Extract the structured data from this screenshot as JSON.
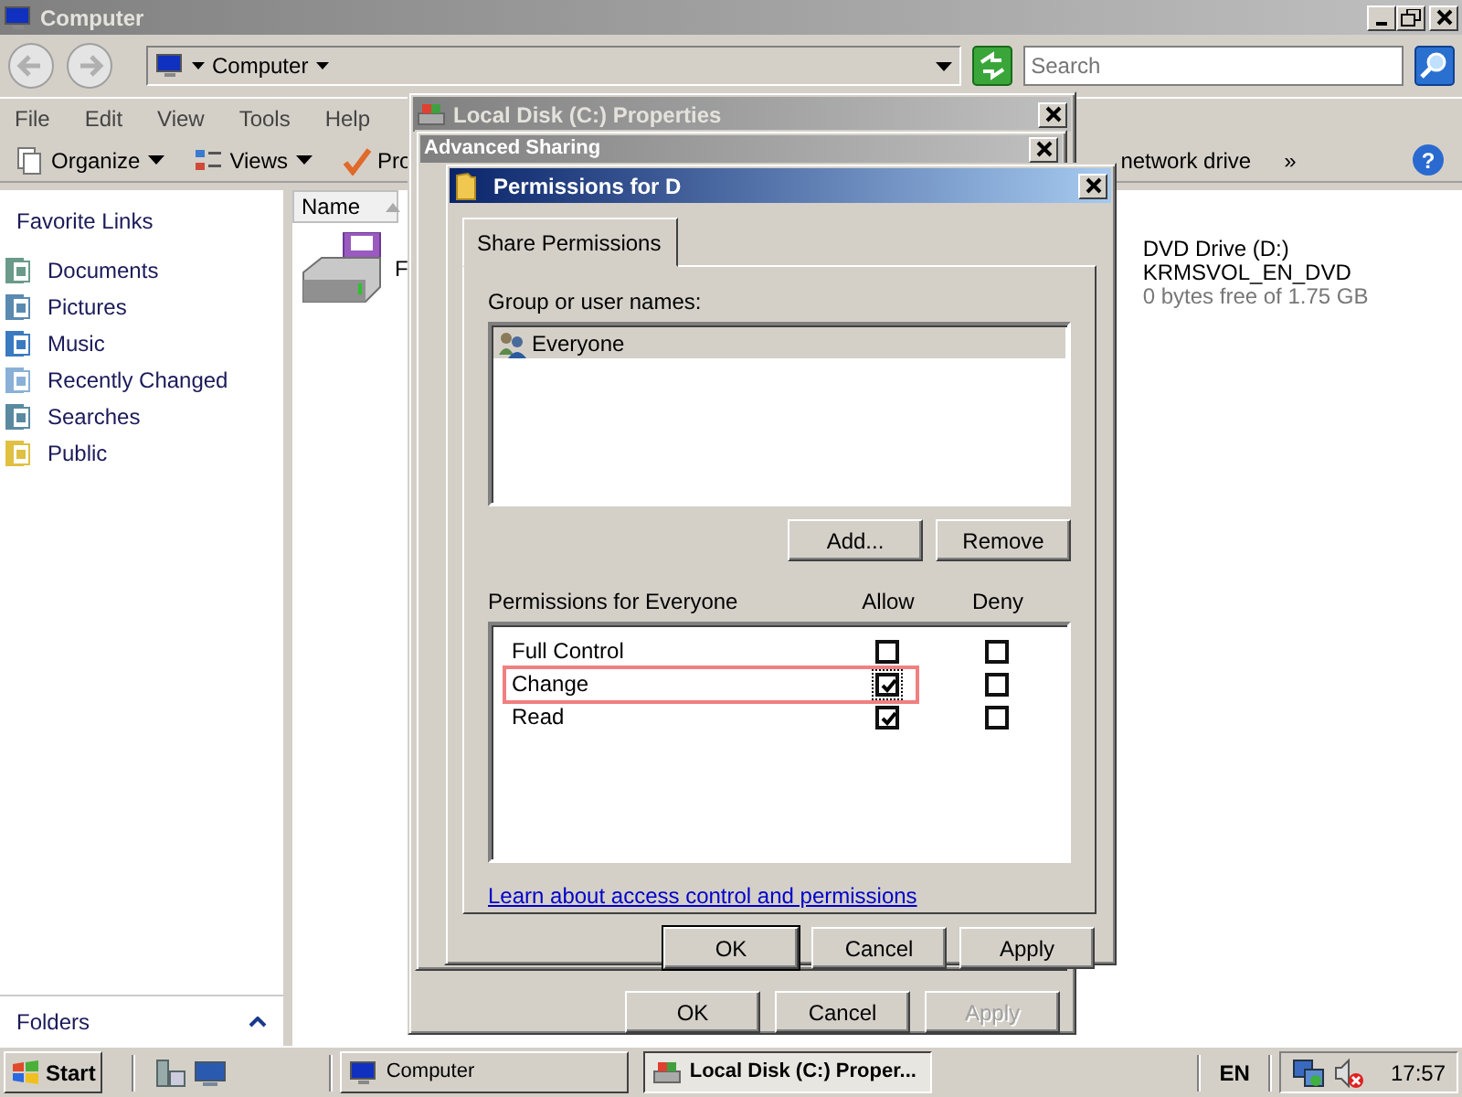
{
  "explorer": {
    "title": "Computer",
    "address": "Computer",
    "search": {
      "placeholder": "Search"
    },
    "menu": [
      "File",
      "Edit",
      "View",
      "Tools",
      "Help"
    ],
    "toolbar_left": [
      "Organize",
      "Views",
      "Pro"
    ],
    "toolbar_right": [
      "network drive",
      "»"
    ],
    "help": "?",
    "favorites": {
      "heading": "Favorite Links",
      "items": [
        "Documents",
        "Pictures",
        "Music",
        "Recently Changed",
        "Searches",
        "Public"
      ]
    },
    "folders_label": "Folders",
    "columns": [
      "Name"
    ],
    "drive_left": "F",
    "dvd": {
      "name": "DVD Drive (D:)",
      "label": "KRMSVOL_EN_DVD",
      "free": "0 bytes free of 1.75 GB"
    }
  },
  "properties_dialog": {
    "title": "Local Disk (C:) Properties",
    "buttons": [
      {
        "label": "OK",
        "disabled": false
      },
      {
        "label": "Cancel",
        "disabled": false
      },
      {
        "label": "Apply",
        "disabled": true
      }
    ]
  },
  "advanced_sharing_dialog": {
    "title": "Advanced Sharing"
  },
  "permissions_dialog": {
    "title": "Permissions for D",
    "tabs": [
      {
        "label": "Share Permissions",
        "selected": true
      }
    ],
    "group_label": "Group or user names:",
    "users": [
      {
        "name": "Everyone",
        "selected": true
      }
    ],
    "user_buttons": [
      "Add...",
      "Remove"
    ],
    "permissions_label": "Permissions for Everyone",
    "allow_label": "Allow",
    "deny_label": "Deny",
    "permissions": [
      {
        "name": "Full Control",
        "allow": false,
        "deny": false,
        "highlighted": false,
        "focused": false
      },
      {
        "name": "Change",
        "allow": true,
        "deny": false,
        "highlighted": true,
        "focused": true
      },
      {
        "name": "Read",
        "allow": true,
        "deny": false,
        "highlighted": false,
        "focused": false
      }
    ],
    "link": "Learn about access control and permissions",
    "buttons": [
      {
        "label": "OK",
        "default": true,
        "disabled": false
      },
      {
        "label": "Cancel",
        "default": false,
        "disabled": false
      },
      {
        "label": "Apply",
        "default": false,
        "disabled": false
      }
    ]
  },
  "taskbar": {
    "start": "Start",
    "tasks": [
      {
        "label": "Computer",
        "selected": false
      },
      {
        "label": "Local Disk (C:) Proper...",
        "selected": true
      }
    ],
    "language": "EN",
    "clock": "17:57"
  }
}
